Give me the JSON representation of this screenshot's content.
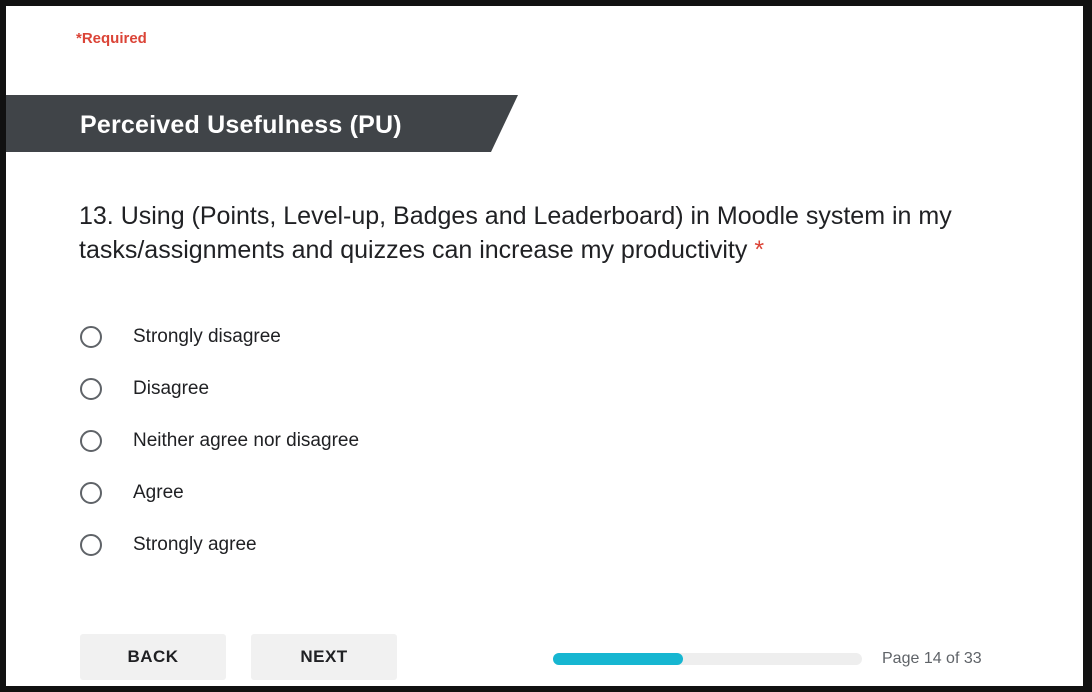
{
  "form": {
    "required_note": "*Required",
    "section_title": "Perceived Usefulness (PU)",
    "question": {
      "text": "13. Using (Points, Level-up, Badges and Leaderboard) in Moodle system in my tasks/assignments and quizzes can increase my productivity",
      "required_marker": "*"
    },
    "options": [
      {
        "label": "Strongly disagree"
      },
      {
        "label": "Disagree"
      },
      {
        "label": "Neither agree nor disagree"
      },
      {
        "label": "Agree"
      },
      {
        "label": "Strongly agree"
      }
    ],
    "buttons": {
      "back_label": "BACK",
      "next_label": "NEXT"
    },
    "progress": {
      "fraction": 0.42,
      "color": "#16b6d1"
    },
    "page_indicator": "Page 14 of 33"
  },
  "colors": {
    "section_header_bg": "#404448",
    "required_red": "#db4437",
    "button_bg": "#f1f1f1"
  }
}
